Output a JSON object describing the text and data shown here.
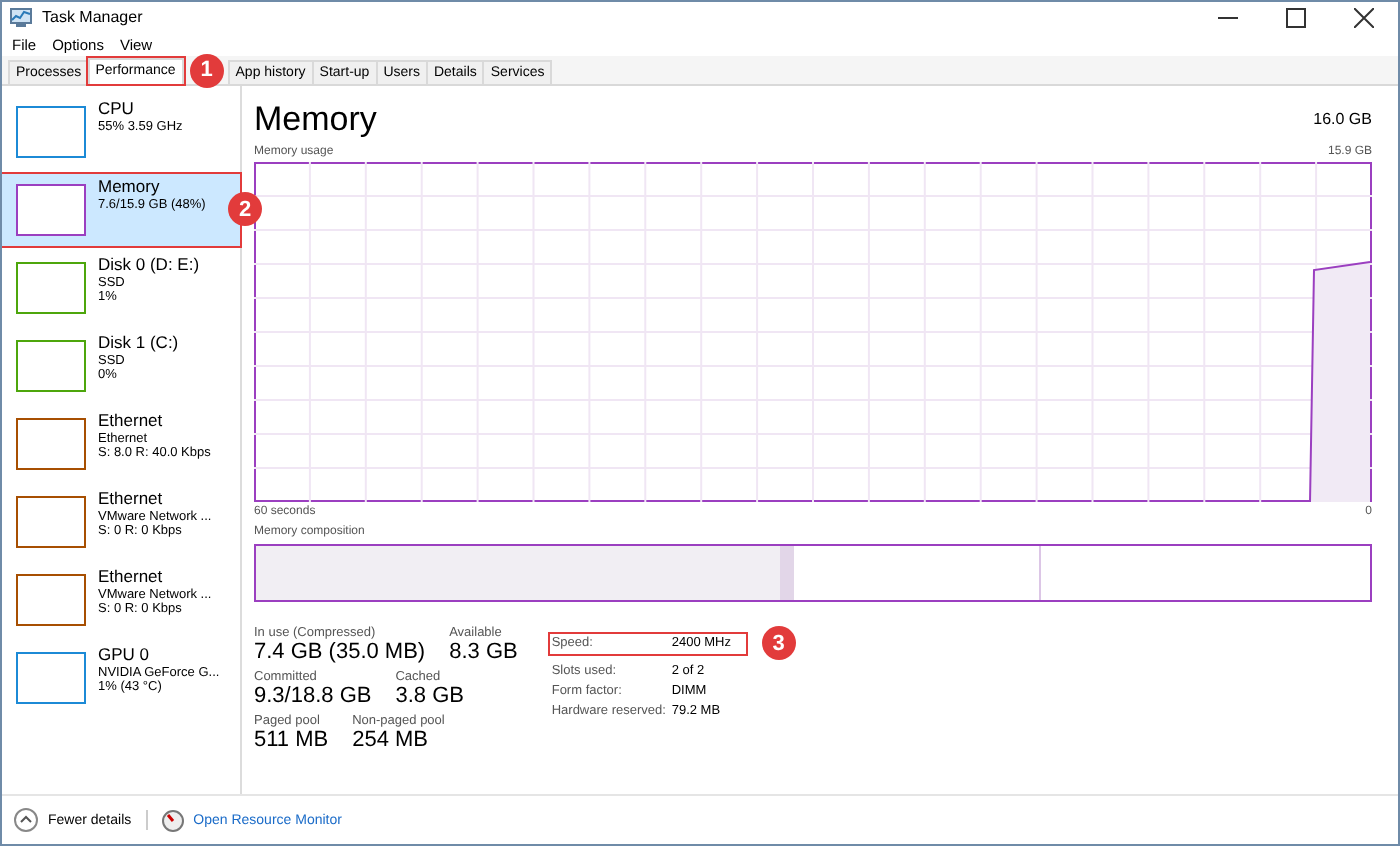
{
  "window": {
    "title": "Task Manager"
  },
  "menu": [
    "File",
    "Options",
    "View"
  ],
  "tabs": [
    {
      "label": "Processes",
      "selected": false,
      "highlighted": false
    },
    {
      "label": "Performance",
      "selected": true,
      "highlighted": true,
      "badge": "1"
    },
    {
      "label": "App history",
      "selected": false,
      "highlighted": false
    },
    {
      "label": "Start-up",
      "selected": false,
      "highlighted": false
    },
    {
      "label": "Users",
      "selected": false,
      "highlighted": false
    },
    {
      "label": "Details",
      "selected": false,
      "highlighted": false
    },
    {
      "label": "Services",
      "selected": false,
      "highlighted": false
    }
  ],
  "sidebar": {
    "items": [
      {
        "name": "CPU",
        "lines": [
          "55% 3.59 GHz"
        ],
        "color": "#1c8ad6",
        "selected": false,
        "highlighted": false
      },
      {
        "name": "Memory",
        "lines": [
          "7.6/15.9 GB (48%)"
        ],
        "color": "#9b3fc0",
        "selected": true,
        "highlighted": true,
        "badge": "2"
      },
      {
        "name": "Disk 0 (D: E:)",
        "lines": [
          "SSD",
          "1%"
        ],
        "color": "#4da60c",
        "selected": false,
        "highlighted": false
      },
      {
        "name": "Disk 1 (C:)",
        "lines": [
          "SSD",
          "0%"
        ],
        "color": "#4da60c",
        "selected": false,
        "highlighted": false
      },
      {
        "name": "Ethernet",
        "lines": [
          "Ethernet",
          "S: 8.0 R: 40.0 Kbps"
        ],
        "color": "#a74f01",
        "selected": false,
        "highlighted": false
      },
      {
        "name": "Ethernet",
        "lines": [
          "VMware Network ...",
          "S: 0 R: 0 Kbps"
        ],
        "color": "#a74f01",
        "selected": false,
        "highlighted": false
      },
      {
        "name": "Ethernet",
        "lines": [
          "VMware Network ...",
          "S: 0 R: 0 Kbps"
        ],
        "color": "#a74f01",
        "selected": false,
        "highlighted": false
      },
      {
        "name": "GPU 0",
        "lines": [
          "NVIDIA GeForce G...",
          "1% (43 °C)"
        ],
        "color": "#1c8ad6",
        "selected": false,
        "highlighted": false
      }
    ]
  },
  "main": {
    "title": "Memory",
    "total": "16.0 GB",
    "usage_label": "Memory usage",
    "usage_max": "15.9 GB",
    "time_span": "60 seconds",
    "time_end": "0",
    "composition_label": "Memory composition",
    "stats": [
      [
        {
          "label": "In use (Compressed)",
          "value": "7.4 GB (35.0 MB)"
        },
        {
          "label": "Available",
          "value": "8.3 GB"
        }
      ],
      [
        {
          "label": "Committed",
          "value": "9.3/18.8 GB"
        },
        {
          "label": "Cached",
          "value": "3.8 GB"
        }
      ],
      [
        {
          "label": "Paged pool",
          "value": "511 MB"
        },
        {
          "label": "Non-paged pool",
          "value": "254 MB"
        }
      ]
    ],
    "specs": [
      {
        "label": "Speed:",
        "value": "2400 MHz",
        "highlighted": true,
        "badge": "3"
      },
      {
        "label": "Slots used:",
        "value": "2 of 2",
        "highlighted": false
      },
      {
        "label": "Form factor:",
        "value": "DIMM",
        "highlighted": false
      },
      {
        "label": "Hardware reserved:",
        "value": "79.2 MB",
        "highlighted": false
      }
    ]
  },
  "footer": {
    "fewer": "Fewer details",
    "link": "Open Resource Monitor"
  }
}
